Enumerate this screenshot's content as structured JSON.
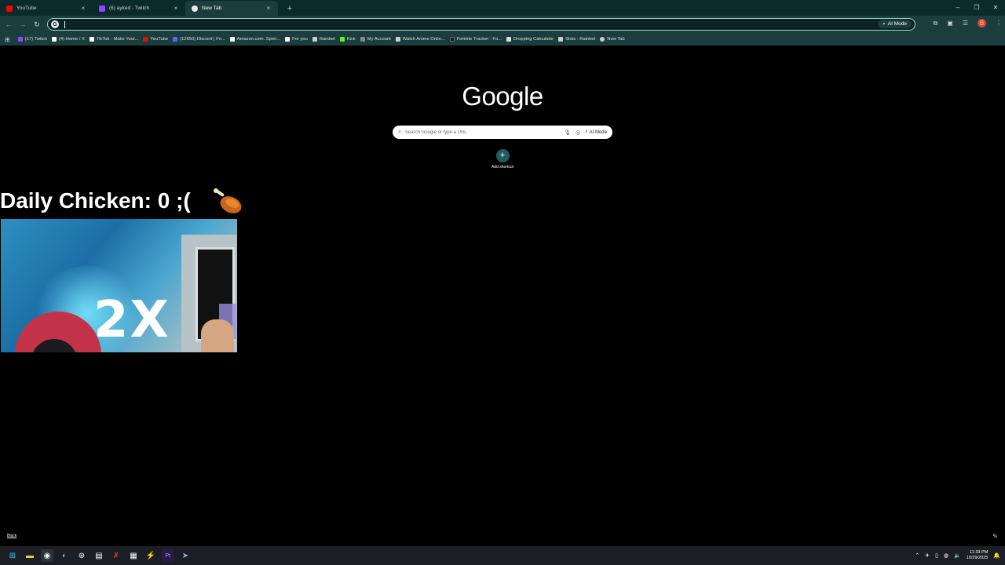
{
  "tabs": [
    {
      "title": "YouTube",
      "color": "#ff0000",
      "active": false
    },
    {
      "title": "(6) ayked - Twitch",
      "color": "#9146ff",
      "active": false
    },
    {
      "title": "New Tab",
      "color": "#e8eaed",
      "active": true
    }
  ],
  "toolbar": {
    "omnibox_value": "",
    "ai_mode_label": "AI Mode",
    "profile_initial": "B"
  },
  "bookmarks": [
    {
      "label": "(17) Twitch",
      "color": "#9146ff"
    },
    {
      "label": "(4) Home / X",
      "color": "#ffffff"
    },
    {
      "label": "TikTok - Make Your...",
      "color": "#ffffff"
    },
    {
      "label": "YouTube",
      "color": "#ff0000"
    },
    {
      "label": "(12650) Discord | Fri...",
      "color": "#5865f2"
    },
    {
      "label": "Amazon.com. Spen...",
      "color": "#ffffff"
    },
    {
      "label": "For you",
      "color": "#ffffff"
    },
    {
      "label": "Rainbet",
      "color": "#cccccc"
    },
    {
      "label": "Kick",
      "color": "#53fc18"
    },
    {
      "label": "My Account",
      "color": "#888888"
    },
    {
      "label": "Watch Anime Onlin...",
      "color": "#cccccc"
    },
    {
      "label": "Fortnite Tracker - Fo...",
      "color": "#222222"
    },
    {
      "label": "Dropping Calculator",
      "color": "#dddddd"
    },
    {
      "label": "Slots - Rainbet",
      "color": "#cccccc"
    },
    {
      "label": "New Tab",
      "color": "#cccccc"
    }
  ],
  "ntp": {
    "logo": "Google",
    "search_placeholder": "Search Google or type a URL",
    "ai_mode_label": "AI Mode",
    "add_shortcut_label": "Add shortcut",
    "footer_link": "Black"
  },
  "overlay": {
    "daily_chicken": "Daily Chicken: 0 ;(",
    "multiplier": "2X"
  },
  "taskbar": {
    "time": "11:33 PM",
    "date": "10/29/2025"
  }
}
